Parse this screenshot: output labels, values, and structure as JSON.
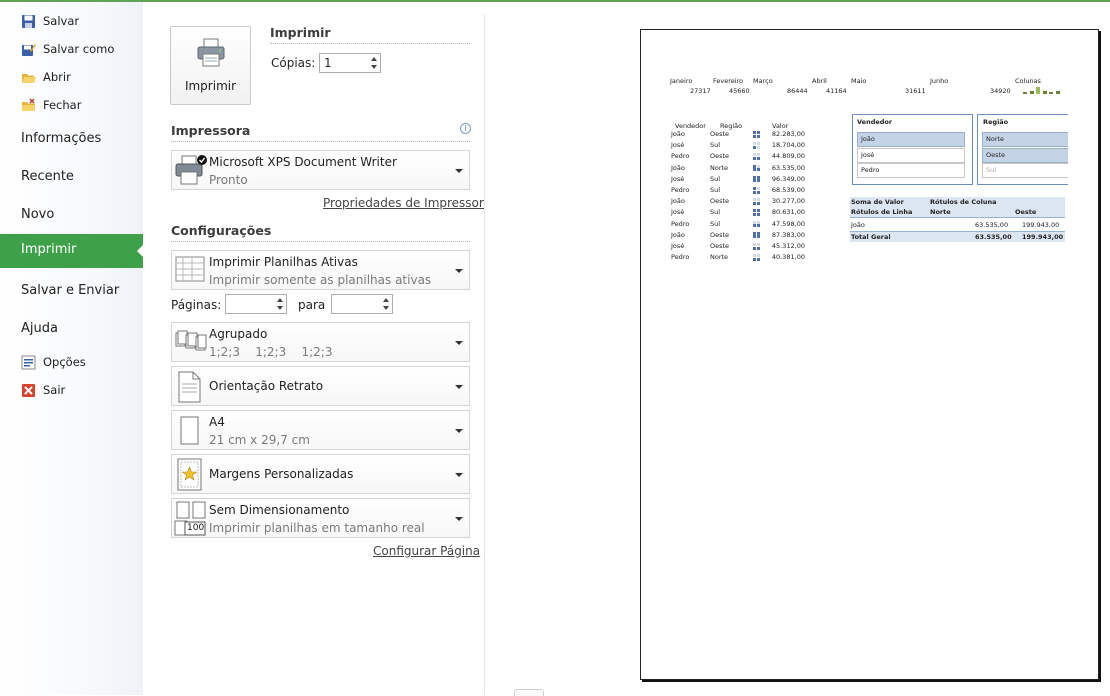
{
  "sidebar": {
    "small_top": [
      {
        "label": "Salvar",
        "icon": "save-icon"
      },
      {
        "label": "Salvar como",
        "icon": "save-as-icon"
      },
      {
        "label": "Abrir",
        "icon": "open-folder-icon"
      },
      {
        "label": "Fechar",
        "icon": "close-folder-icon"
      }
    ],
    "big": [
      {
        "label": "Informações"
      },
      {
        "label": "Recente"
      },
      {
        "label": "Novo"
      },
      {
        "label": "Imprimir"
      },
      {
        "label": "Salvar e Enviar"
      },
      {
        "label": "Ajuda"
      }
    ],
    "small_bottom": [
      {
        "label": "Opções",
        "icon": "options-icon"
      },
      {
        "label": "Sair",
        "icon": "exit-icon"
      }
    ]
  },
  "print": {
    "button_label": "Imprimir",
    "heading": "Imprimir",
    "copies_label": "Cópias:",
    "copies_value": "1"
  },
  "printer": {
    "heading": "Impressora",
    "name": "Microsoft XPS Document Writer",
    "status": "Pronto",
    "properties_link": "Propriedades de Impressora"
  },
  "settings": {
    "heading": "Configurações",
    "scope": {
      "title": "Imprimir Planilhas Ativas",
      "subtitle": "Imprimir somente as planilhas ativas"
    },
    "pages_label": "Páginas:",
    "pages_to_label": "para",
    "collate": {
      "title": "Agrupado",
      "subtitle": "1;2;3    1;2;3    1;2;3"
    },
    "orientation": {
      "title": "Orientação Retrato"
    },
    "paper": {
      "title": "A4",
      "subtitle": "21 cm x 29,7 cm"
    },
    "margins": {
      "title": "Margens Personalizadas"
    },
    "scaling": {
      "title": "Sem Dimensionamento",
      "subtitle": "Imprimir planilhas em tamanho real",
      "icon_text": "100"
    },
    "page_setup_link": "Configurar Página"
  },
  "preview": {
    "months": {
      "headers": [
        "Janeiro",
        "Fevereiro",
        "Março",
        "Abril",
        "Maio",
        "Junho",
        "Colunas"
      ],
      "values": [
        "27317",
        "45660",
        "86444",
        "41164",
        "31611",
        "34920"
      ],
      "spark_heights": [
        0.3,
        0.5,
        1.0,
        0.45,
        0.35,
        0.4
      ]
    },
    "table": {
      "headers": [
        "Vendedor",
        "Região",
        "Valor"
      ],
      "rows": [
        [
          "João",
          "Oeste",
          "82.283,00"
        ],
        [
          "José",
          "Sul",
          "18.704,00"
        ],
        [
          "Pedro",
          "Oeste",
          "44.809,00"
        ],
        [
          "João",
          "Norte",
          "63.535,00"
        ],
        [
          "José",
          "Sul",
          "96.349,00"
        ],
        [
          "Pedro",
          "Sul",
          "68.539,00"
        ],
        [
          "João",
          "Oeste",
          "30.277,00"
        ],
        [
          "José",
          "Sul",
          "80.631,00"
        ],
        [
          "Pedro",
          "Sul",
          "47.598,00"
        ],
        [
          "João",
          "Oeste",
          "87.383,00"
        ],
        [
          "José",
          "Oeste",
          "45.312,00"
        ],
        [
          "Pedro",
          "Norte",
          "40.381,00"
        ]
      ],
      "icon_levels": [
        4,
        1,
        2,
        3,
        4,
        3,
        2,
        4,
        2,
        4,
        2,
        2
      ]
    },
    "slicer_vendedor": {
      "title": "Vendedor",
      "items": [
        "João",
        "José",
        "Pedro"
      ],
      "selected": [
        true,
        false,
        false
      ]
    },
    "slicer_regiao": {
      "title": "Região",
      "items": [
        "Norte",
        "Oeste",
        "Sul"
      ],
      "selected": [
        true,
        true,
        false
      ]
    },
    "pivot": {
      "r1": [
        "Soma de Valor",
        "Rótulos de Coluna",
        ""
      ],
      "r2": [
        "Rótulos de Linha",
        "Norte",
        "Oeste"
      ],
      "r3": [
        "João",
        "63.535,00",
        "199.943,00"
      ],
      "r4": [
        "Total Geral",
        "63.535,00",
        "199.943,00"
      ]
    }
  },
  "colors": {
    "accent": "#3ea14a",
    "topline": "#5fa353",
    "slicer_selected": "#c5d3e6"
  }
}
